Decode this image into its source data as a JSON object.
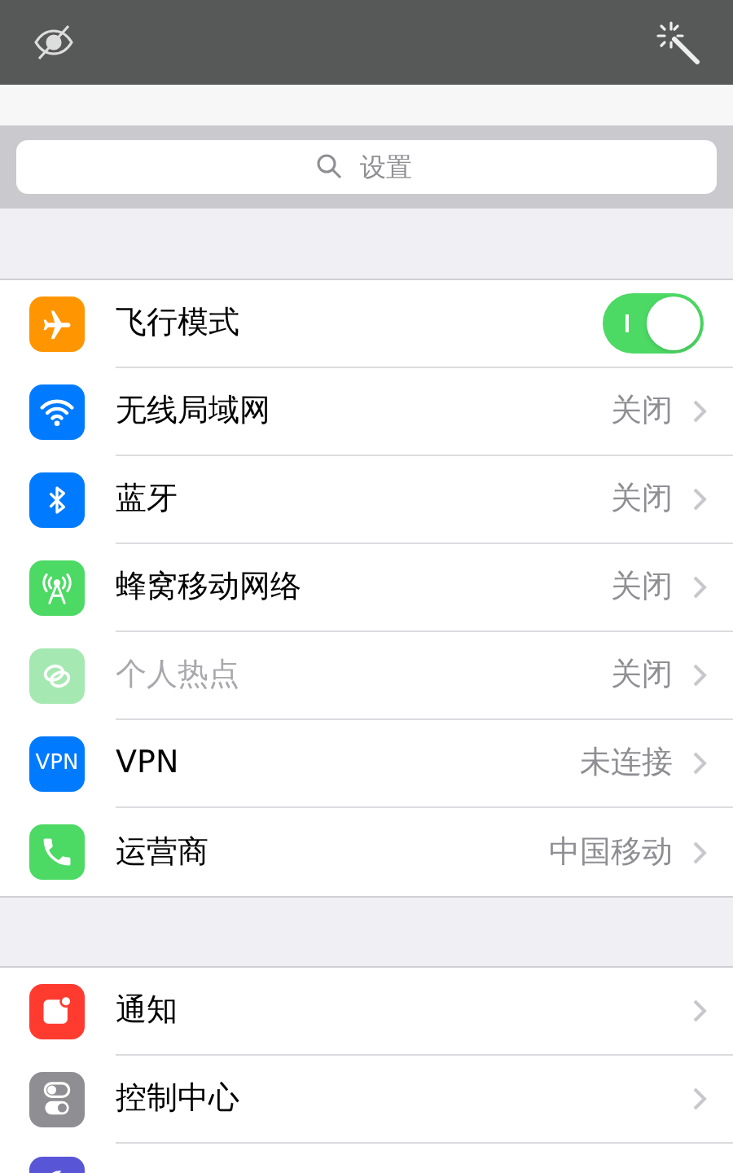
{
  "search": {
    "placeholder": "设置"
  },
  "groups": [
    {
      "rows": [
        {
          "kind": "toggle",
          "label": "飞行模式",
          "color": "#ff9500",
          "on": true
        },
        {
          "kind": "link",
          "label": "无线局域网",
          "color": "#007aff",
          "value": "关闭"
        },
        {
          "kind": "link",
          "label": "蓝牙",
          "color": "#007aff",
          "value": "关闭"
        },
        {
          "kind": "link",
          "label": "蜂窝移动网络",
          "color": "#4cd964",
          "value": "关闭"
        },
        {
          "kind": "link",
          "label": "个人热点",
          "color": "#a6e8b1",
          "value": "关闭",
          "disabled": true
        },
        {
          "kind": "link",
          "label": "VPN",
          "color": "#007aff",
          "icon_text": "VPN",
          "value": "未连接"
        },
        {
          "kind": "link",
          "label": "运营商",
          "color": "#4cd964",
          "value": "中国移动"
        }
      ]
    },
    {
      "rows": [
        {
          "kind": "link",
          "label": "通知",
          "color": "#ff3b30"
        },
        {
          "kind": "link",
          "label": "控制中心",
          "color": "#8e8e93"
        },
        {
          "kind": "cut",
          "color": "#5856d6"
        }
      ]
    }
  ]
}
